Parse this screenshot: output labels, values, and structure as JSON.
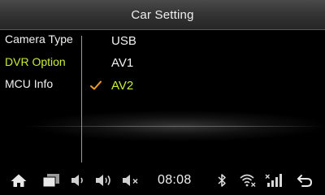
{
  "window": {
    "title": "Car Setting"
  },
  "left_menu": {
    "items": [
      {
        "label": "Camera Type",
        "active": false
      },
      {
        "label": "DVR Option",
        "active": true
      },
      {
        "label": "MCU Info",
        "active": false
      }
    ]
  },
  "options": {
    "items": [
      {
        "label": "USB",
        "selected": false
      },
      {
        "label": "AV1",
        "selected": false
      },
      {
        "label": "AV2",
        "selected": true
      }
    ],
    "selected_color": "#c8ee38",
    "check_color": "#f0a020"
  },
  "status_bar": {
    "time": "08:08",
    "icons": [
      "home-icon",
      "recent-apps-icon",
      "volume-mute-low-icon",
      "volume-high-icon",
      "volume-muted-icon",
      "bluetooth-icon",
      "wifi-off-icon",
      "signal-off-icon",
      "back-icon"
    ]
  },
  "colors": {
    "accent": "#c8ee38",
    "text": "#f2f2f2",
    "background": "#000000"
  }
}
